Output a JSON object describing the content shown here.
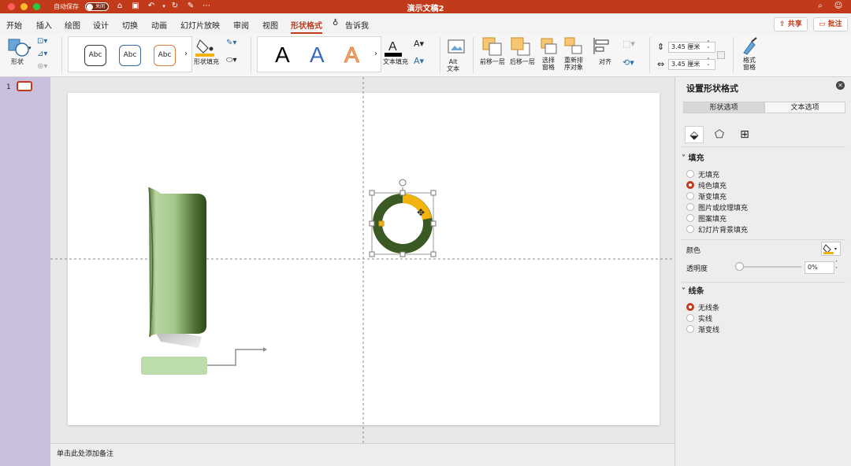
{
  "title_bar": {
    "autosave_label": "自动保存",
    "autosave_state": "关闭",
    "document_title": "演示文稿2"
  },
  "tabs": [
    "开始",
    "插入",
    "绘图",
    "设计",
    "切换",
    "动画",
    "幻灯片放映",
    "审阅",
    "视图",
    "形状格式"
  ],
  "active_tab": "形状格式",
  "tell_me": "告诉我",
  "share_label": "共享",
  "comments_label": "批注",
  "ribbon": {
    "shape_label": "形状",
    "style_samples": [
      "Abc",
      "Abc",
      "Abc"
    ],
    "shape_fill_label": "形状填充",
    "wordart_letters": [
      "A",
      "A",
      "A"
    ],
    "text_fill_label": "文本填充",
    "alt_text_label": "Alt\n文本",
    "bring_forward_label": "前移一层",
    "send_backward_label": "后移一层",
    "selection_pane_label": "选择\n窗格",
    "reorder_label": "重新排\n序对象",
    "align_label": "对齐",
    "height_value": "3.45 厘米",
    "width_value": "3.45 厘米",
    "format_pane_label": "格式\n窗格"
  },
  "slide_number": "1",
  "notes_placeholder": "单击此处添加备注",
  "format_panel": {
    "title": "设置形状格式",
    "tab_shape": "形状选项",
    "tab_text": "文本选项",
    "fill_header": "填充",
    "fill_options": [
      "无填充",
      "纯色填充",
      "渐变填充",
      "图片或纹理填充",
      "图案填充",
      "幻灯片背景填充"
    ],
    "fill_selected": "纯色填充",
    "color_label": "颜色",
    "transparency_label": "透明度",
    "transparency_value": "0%",
    "line_header": "线条",
    "line_options": [
      "无线条",
      "实线",
      "渐变线"
    ],
    "line_selected": "无线条"
  },
  "colors": {
    "accent": "#c13b1b",
    "ring": "#3b5a23",
    "ring_highlight": "#f2b40c",
    "fill_swatch": "#f2b40c"
  }
}
